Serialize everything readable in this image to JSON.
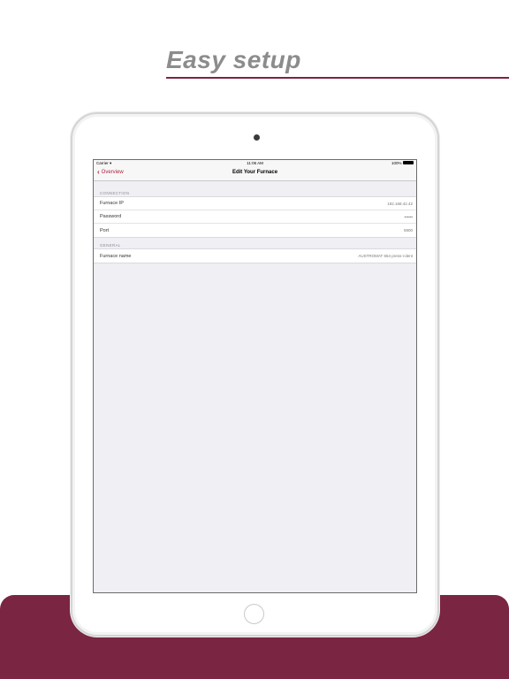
{
  "headline": "Easy setup",
  "colors": {
    "brand": "#7a2541",
    "accent": "#b0243d",
    "headline": "#8c8c8c"
  },
  "device": {
    "status_bar": {
      "carrier": "Carrier",
      "time": "11:06 AM",
      "battery": "100%"
    },
    "nav": {
      "back_label": "Overview",
      "back_icon": "chevron-left-icon",
      "title": "Edit Your Furnace"
    },
    "sections": [
      {
        "header": "CONNECTION",
        "rows": [
          {
            "label": "Furnace IP",
            "value": "192.168.42.42"
          },
          {
            "label": "Password",
            "value": "••••••"
          },
          {
            "label": "Port",
            "value": "5900"
          }
        ]
      },
      {
        "header": "GENERAL",
        "rows": [
          {
            "label": "Furnace name",
            "value": "AUSTROMAT 654 press-i-dent"
          }
        ]
      }
    ]
  }
}
